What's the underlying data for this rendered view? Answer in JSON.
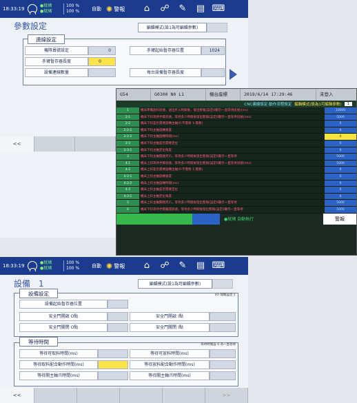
{
  "top": {
    "status": {
      "time": "18:33:19",
      "ready1": "●就緒",
      "ready2": "●就緒",
      "pct1": "100  %",
      "pct2": "100  %",
      "auto": "自動",
      "alarm": "警報"
    },
    "title": "參數設定",
    "mode": "編輯模式(設1為可編輯參數)",
    "section": "連線設定",
    "fields": [
      {
        "label": "機隊員號設定",
        "value": "0"
      },
      {
        "label": "手臂暫存器長度",
        "value": "0"
      },
      {
        "label": "設備連線數量",
        "value": ""
      }
    ],
    "fields_right": [
      {
        "label": "手臂起始暫存器位置",
        "value": "1024"
      },
      {
        "label": "每台設備暫存器長度",
        "value": ""
      }
    ],
    "nav_prev": "<<"
  },
  "cnc": {
    "header": [
      "G54",
      "G0300 N0 L1",
      "機台座標",
      "2019/6/14 17:29:46",
      "未登入"
    ],
    "sub_title": "CNC連線設定-動作流程設定",
    "sub_mode": "編輯模式(設為1可編輯參數)",
    "sub_value": "1",
    "rows": [
      {
        "id": "1",
        "text": "機床準備放料訊號，送出步入時間後，發出暫報(設定0顯示一直等待訊號)(ms)",
        "value": "10000",
        "yellow": false
      },
      {
        "id": "2-1",
        "text": "機床下料等待手臂訊號，等待多少時間後發出暫報(設定0顯示一直等待訊號)(ms)",
        "value": "5000",
        "yellow": false
      },
      {
        "id": "2-2",
        "text": "機床下料是否需要旋轉主軸(0:不需要 1:需要)",
        "value": "0",
        "yellow": false
      },
      {
        "id": "2-2-1",
        "text": "機床下料主軸旋轉速度",
        "value": "0",
        "yellow": false
      },
      {
        "id": "2-2-2",
        "text": "機床下料主軸旋轉時間(ms)",
        "value": "0",
        "yellow": true
      },
      {
        "id": "2-3",
        "text": "機床下料主軸是否需要定位",
        "value": "0",
        "yellow": false
      },
      {
        "id": "2-3-1",
        "text": "機床下料主軸定位角度",
        "value": "0",
        "yellow": false
      },
      {
        "id": "3",
        "text": "機床下料主軸開啟夾爪，等待多少時間後發出暫報(設定0顯示一直等待",
        "value": "5000",
        "yellow": false
      },
      {
        "id": "4-1",
        "text": "機床上料等待手臂訊號，等待多少時間後發出暫報(設定0顯示一直等待訊號)(ms)",
        "value": "5000",
        "yellow": false
      },
      {
        "id": "4-2",
        "text": "機床上料是否需要旋轉主軸(0:不需要 1:需要)",
        "value": "0",
        "yellow": false
      },
      {
        "id": "4-2-1",
        "text": "機床上料主軸旋轉速度",
        "value": "0",
        "yellow": false
      },
      {
        "id": "4-2-2",
        "text": "機床上料主軸旋轉時間(ms)",
        "value": "0",
        "yellow": false
      },
      {
        "id": "4-3",
        "text": "機床上料主軸是否需要定位",
        "value": "0",
        "yellow": false
      },
      {
        "id": "4-3-1",
        "text": "機床上料主軸定位角度",
        "value": "0",
        "yellow": false
      },
      {
        "id": "5",
        "text": "機床上料主軸關閉夾爪，等待多少時間後發出暫報(設定0顯示一直等待",
        "value": "5000",
        "yellow": false
      },
      {
        "id": "6",
        "text": "機床下料等待手臂離開訊號，等待多少時間後發出暫報(設定0顯示一直等待",
        "value": "5000",
        "yellow": false
      }
    ],
    "footer_text": "●就緒    自動執行",
    "footer_alarm": "警報"
  },
  "bottom": {
    "status": {
      "time": "18:33:19",
      "ready1": "●就緒",
      "ready2": "●就緒",
      "pct1": "100  %",
      "pct2": "100  %",
      "auto": "自動",
      "alarm": "警報"
    },
    "title": "設備　1",
    "mode": "編輯模式(設1為可編輯參數)",
    "section1": "設備設定",
    "section1_note": "I/O 開關設定-1",
    "start_label": "設備起始暫存器位置",
    "io_rows": [
      {
        "left": "安全門開啟 O點",
        "right": "安全門開啟 I點"
      },
      {
        "left": "安全門關閉 O點",
        "right": "安全門關閉 I點"
      }
    ],
    "section2": "等待時間",
    "section2_note": "等待時間設 0 為一直等待",
    "wait_rows": [
      {
        "left": "等待可取料時間(ms)",
        "right": "等待可放料時間(ms)",
        "left_yellow": false
      },
      {
        "left": "等待取料配合動作時間(ms)",
        "right": "等待放料配合動作時間(ms)",
        "left_yellow": true
      },
      {
        "left": "等待開主軸爪時間(ms)",
        "right": "等待關主軸爪時間(ms)",
        "left_yellow": false
      }
    ],
    "nav_prev": "<<",
    "nav_next": ">>"
  }
}
